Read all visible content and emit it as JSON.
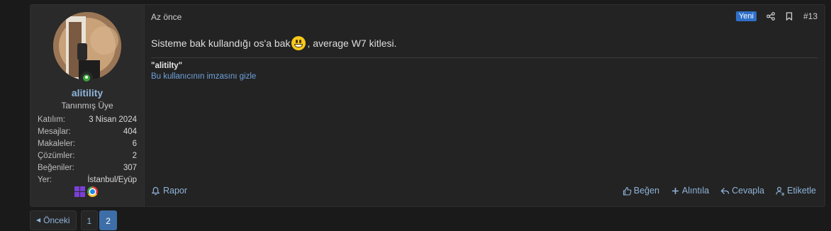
{
  "user": {
    "name": "alitility",
    "title": "Tanınmış Üye",
    "stats": [
      {
        "label": "Katılım:",
        "value": "3 Nisan 2024"
      },
      {
        "label": "Mesajlar:",
        "value": "404"
      },
      {
        "label": "Makaleler:",
        "value": "6"
      },
      {
        "label": "Çözümler:",
        "value": "2"
      },
      {
        "label": "Beğeniler:",
        "value": "307"
      },
      {
        "label": "Yer:",
        "value": "İstanbul/Eyüp"
      }
    ],
    "os_icons": [
      "windows-icon",
      "chrome-icon"
    ]
  },
  "post": {
    "time": "Az önce",
    "badge": "Yeni",
    "number": "#13",
    "message_before": "Sisteme bak kullandığı os'a bak",
    "message_after": ", average W7 kitlesi.",
    "signature_text": "\"alitilty\"",
    "signature_hide_link": "Bu kullanıcının imzasını gizle"
  },
  "actions": {
    "report": "Rapor",
    "like": "Beğen",
    "quote": "Alıntıla",
    "reply": "Cevapla",
    "tag": "Etiketle"
  },
  "pagination": {
    "prev": "Önceki",
    "pages": [
      "1",
      "2"
    ],
    "current": "2"
  },
  "colors": {
    "link": "#8fb4d9",
    "badge": "#2f6fc8",
    "online": "#3aa63a"
  }
}
